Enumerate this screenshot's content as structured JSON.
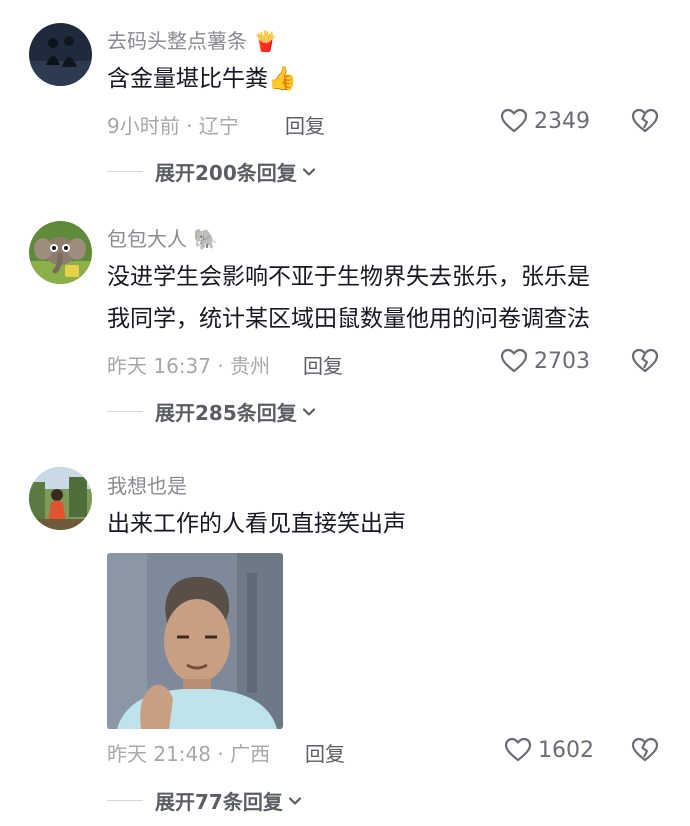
{
  "comments": [
    {
      "username": "去码头整点薯条",
      "username_emoji": "🍟",
      "text_lines": [
        "含金量堪比牛粪"
      ],
      "text_emoji": "👍",
      "meta": "9小时前 · 辽宁",
      "reply_label": "回复",
      "likes": "2349",
      "expand_label": "展开200条回复"
    },
    {
      "username": "包包大人",
      "username_emoji": "🐘",
      "text_lines": [
        "没进学生会影响不亚于生物界失去张乐，张乐是",
        "我同学，统计某区域田鼠数量他用的问卷调查法"
      ],
      "meta": "昨天 16:37 · 贵州",
      "reply_label": "回复",
      "likes": "2703",
      "expand_label": "展开285条回复"
    },
    {
      "username": "我想也是",
      "text_lines": [
        "出来工作的人看见直接笑出声"
      ],
      "meta": "昨天 21:48 · 广西",
      "reply_label": "回复",
      "likes": "1602",
      "expand_label": "展开77条回复"
    }
  ],
  "icons": {
    "like": "heart-outline-icon",
    "dislike": "broken-heart-icon",
    "expand": "chevron-down-icon"
  },
  "colors": {
    "username": "#8a8b91",
    "text": "#161823",
    "meta": "#a7a8ac",
    "action": "#5c5e66"
  }
}
